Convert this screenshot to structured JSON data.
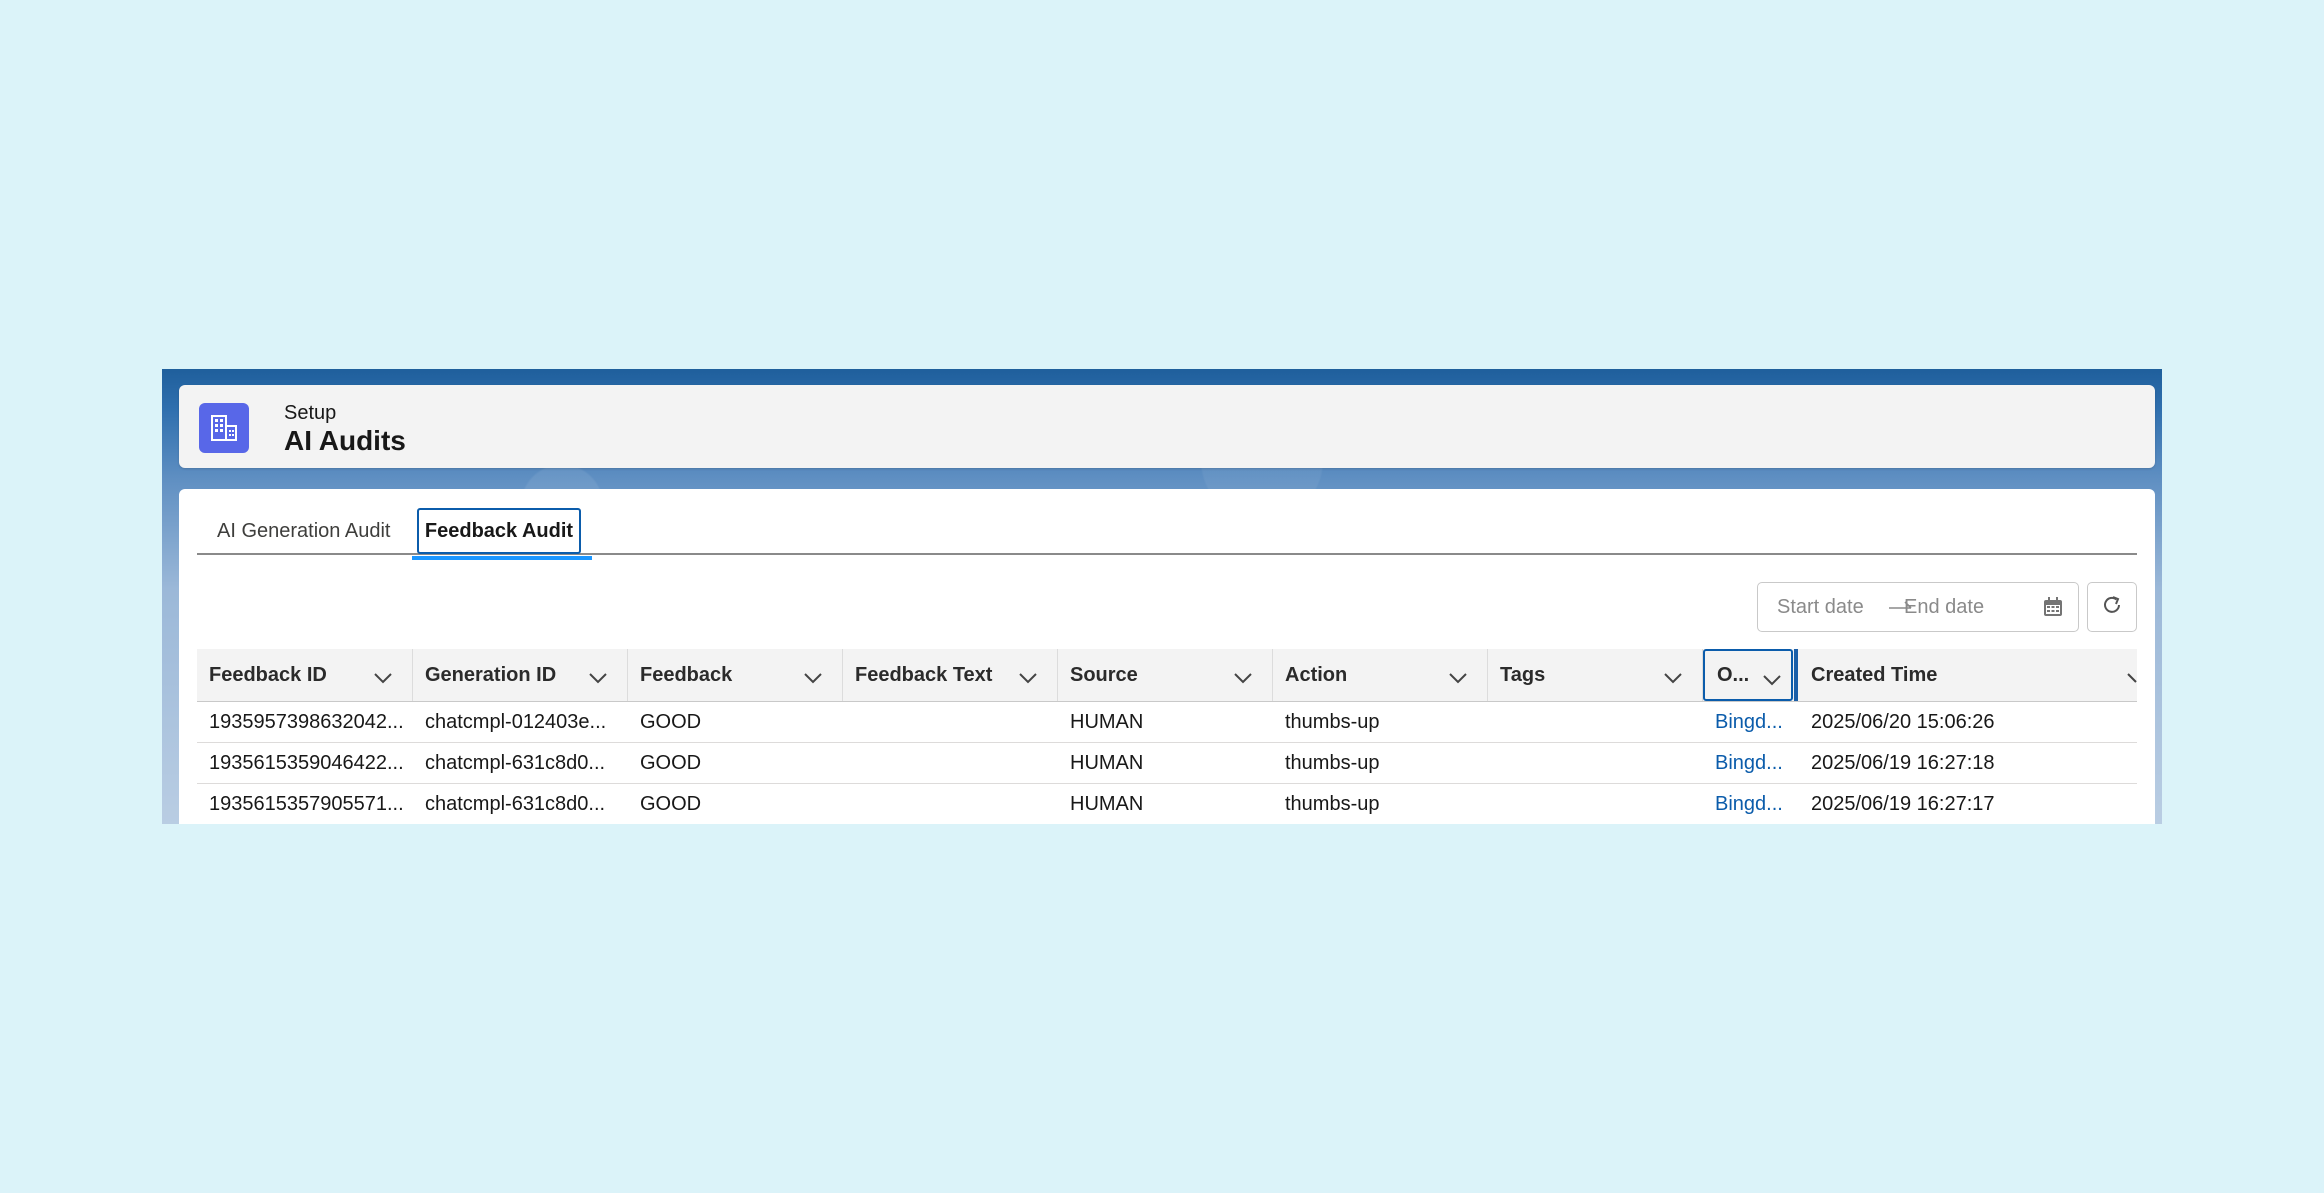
{
  "header": {
    "subtitle": "Setup",
    "title": "AI Audits",
    "icon": "building-grid-icon",
    "icon_color": "#5867e8"
  },
  "tabs": [
    {
      "label": "AI Generation Audit",
      "active": false
    },
    {
      "label": "Feedback Audit",
      "active": true
    }
  ],
  "date_filter": {
    "start_placeholder": "Start date",
    "end_placeholder": "End date"
  },
  "table": {
    "columns": [
      {
        "label": "Feedback ID"
      },
      {
        "label": "Generation ID"
      },
      {
        "label": "Feedback"
      },
      {
        "label": "Feedback Text"
      },
      {
        "label": "Source"
      },
      {
        "label": "Action"
      },
      {
        "label": "Tags"
      },
      {
        "label": "O..."
      },
      {
        "label": "Created Time"
      }
    ],
    "rows": [
      {
        "feedback_id": "1935957398632042...",
        "generation_id": "chatcmpl-012403e...",
        "feedback": "GOOD",
        "feedback_text": "",
        "source": "HUMAN",
        "action": "thumbs-up",
        "tags": "",
        "o": "Bingd...",
        "created_time": "2025/06/20 15:06:26"
      },
      {
        "feedback_id": "1935615359046422...",
        "generation_id": "chatcmpl-631c8d0...",
        "feedback": "GOOD",
        "feedback_text": "",
        "source": "HUMAN",
        "action": "thumbs-up",
        "tags": "",
        "o": "Bingd...",
        "created_time": "2025/06/19 16:27:18"
      },
      {
        "feedback_id": "1935615357905571...",
        "generation_id": "chatcmpl-631c8d0...",
        "feedback": "GOOD",
        "feedback_text": "",
        "source": "HUMAN",
        "action": "thumbs-up",
        "tags": "",
        "o": "Bingd...",
        "created_time": "2025/06/19 16:27:17"
      }
    ]
  },
  "colors": {
    "page_background": "#dbf3f9",
    "accent": "#0b5cab",
    "tab_indicator": "#1b96ff",
    "link": "#0b5cab"
  }
}
